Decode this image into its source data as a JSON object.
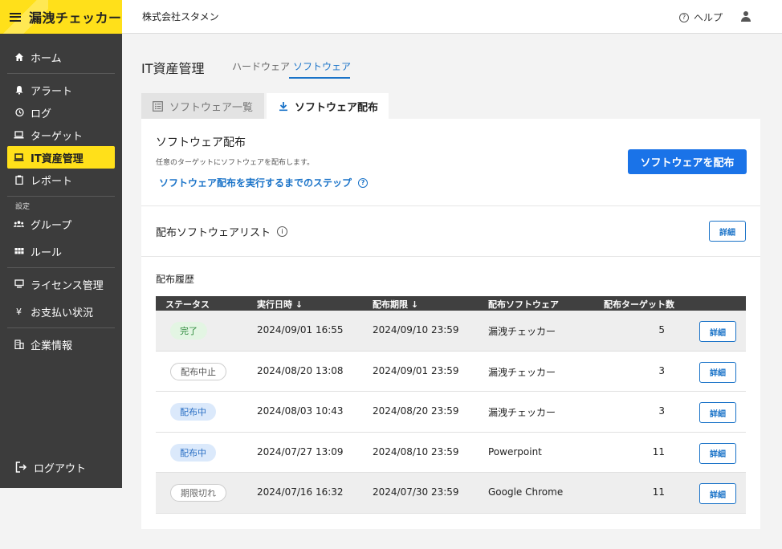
{
  "brand": {
    "title": "漏洩チェッカー"
  },
  "sidebar": {
    "items": [
      {
        "label": "ホーム",
        "icon": "home-icon"
      },
      {
        "label": "アラート",
        "icon": "bell-icon"
      },
      {
        "label": "ログ",
        "icon": "history-icon"
      },
      {
        "label": "ターゲット",
        "icon": "laptop-icon"
      },
      {
        "label": "IT資産管理",
        "icon": "computer-icon",
        "active": true
      },
      {
        "label": "レポート",
        "icon": "clipboard-icon"
      },
      {
        "label": "グループ",
        "icon": "group-icon"
      },
      {
        "label": "ルール",
        "icon": "grid-icon"
      },
      {
        "label": "ライセンス管理",
        "icon": "monitor-icon"
      },
      {
        "label": "お支払い状況",
        "icon": "yen-icon"
      },
      {
        "label": "企業情報",
        "icon": "building-icon"
      }
    ],
    "settings_label": "設定",
    "logout_label": "ログアウト"
  },
  "header": {
    "company": "株式会社スタメン",
    "help_label": "ヘルプ"
  },
  "main": {
    "title": "IT資産管理",
    "subtabs": {
      "hardware": "ハードウェア",
      "software": "ソフトウェア"
    },
    "content_tabs": {
      "list": "ソフトウェア一覧",
      "distribution": "ソフトウェア配布"
    },
    "panel": {
      "title": "ソフトウェア配布",
      "description": "任意のターゲットにソフトウェアを配布します。",
      "steps_link": "ソフトウェア配布を実行するまでのステップ",
      "distribute_button": "ソフトウェアを配布",
      "list_title": "配布ソフトウェアリスト",
      "detail_label": "詳細",
      "history_title": "配布履歴"
    },
    "table": {
      "headers": {
        "status": "ステータス",
        "executed": "実行日時 ↓",
        "deadline": "配布期限 ↓",
        "software": "配布ソフトウェア",
        "targets": "配布ターゲット数"
      },
      "rows": [
        {
          "status": "完了",
          "executed": "2024/09/01 16:55",
          "deadline": "2024/09/10 23:59",
          "software": "漏洩チェッカー",
          "targets": "5"
        },
        {
          "status": "配布中止",
          "executed": "2024/08/20 13:08",
          "deadline": "2024/09/01 23:59",
          "software": "漏洩チェッカー",
          "targets": "3"
        },
        {
          "status": "配布中",
          "executed": "2024/08/03 10:43",
          "deadline": "2024/08/20 23:59",
          "software": "漏洩チェッカー",
          "targets": "3"
        },
        {
          "status": "配布中",
          "executed": "2024/07/27 13:09",
          "deadline": "2024/08/10 23:59",
          "software": "Powerpoint",
          "targets": "11"
        },
        {
          "status": "期限切れ",
          "executed": "2024/07/16 16:32",
          "deadline": "2024/07/30 23:59",
          "software": "Google Chrome",
          "targets": "11"
        }
      ],
      "detail_label": "詳細"
    }
  },
  "colors": {
    "accent": "#ffe01a",
    "primary": "#1a73e8",
    "sidebar": "#3c3c3c"
  }
}
